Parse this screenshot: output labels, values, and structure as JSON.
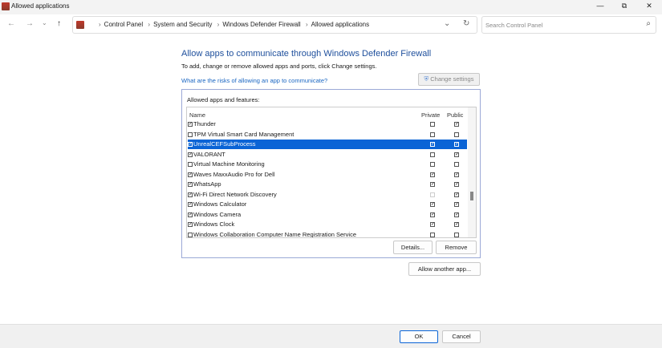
{
  "window": {
    "title": "Allowed applications",
    "minimize": "—",
    "maximize": "⧉",
    "close": "✕"
  },
  "nav": {
    "back": "←",
    "forward": "→",
    "recent": "⌄",
    "up": "↑"
  },
  "address": {
    "crumbs": [
      "Control Panel",
      "System and Security",
      "Windows Defender Firewall",
      "Allowed applications"
    ],
    "dropdown": "⌄",
    "refresh": "↻"
  },
  "search": {
    "placeholder": "Search Control Panel",
    "icon": "⌕"
  },
  "main": {
    "heading": "Allow apps to communicate through Windows Defender Firewall",
    "subtitle": "To add, change or remove allowed apps and ports, click Change settings.",
    "risk_link": "What are the risks of allowing an app to communicate?",
    "change_settings": "Change settings"
  },
  "group": {
    "label": "Allowed apps and features:",
    "columns": {
      "name": "Name",
      "private": "Private",
      "public": "Public"
    },
    "rows": [
      {
        "name": "Thunder",
        "enabled": true,
        "private": false,
        "public": true
      },
      {
        "name": "TPM Virtual Smart Card Management",
        "enabled": false,
        "private": false,
        "public": false
      },
      {
        "name": "UnrealCEFSubProcess",
        "enabled": true,
        "private": true,
        "public": true,
        "selected": true
      },
      {
        "name": "VALORANT",
        "enabled": true,
        "private": false,
        "public": true
      },
      {
        "name": "Virtual Machine Monitoring",
        "enabled": false,
        "private": false,
        "public": false
      },
      {
        "name": "Waves MaxxAudio Pro for Dell",
        "enabled": true,
        "private": true,
        "public": true
      },
      {
        "name": "WhatsApp",
        "enabled": true,
        "private": true,
        "public": true
      },
      {
        "name": "Wi-Fi Direct Network Discovery",
        "enabled": true,
        "private": false,
        "private_disabled": true,
        "public": true
      },
      {
        "name": "Windows Calculator",
        "enabled": true,
        "private": true,
        "public": true
      },
      {
        "name": "Windows Camera",
        "enabled": true,
        "private": true,
        "public": true
      },
      {
        "name": "Windows Clock",
        "enabled": true,
        "private": true,
        "public": true
      },
      {
        "name": "Windows Collaboration Computer Name Registration Service",
        "enabled": false,
        "private": false,
        "public": false
      }
    ],
    "details": "Details...",
    "remove": "Remove"
  },
  "allow_another": "Allow another app...",
  "footer": {
    "ok": "OK",
    "cancel": "Cancel"
  }
}
